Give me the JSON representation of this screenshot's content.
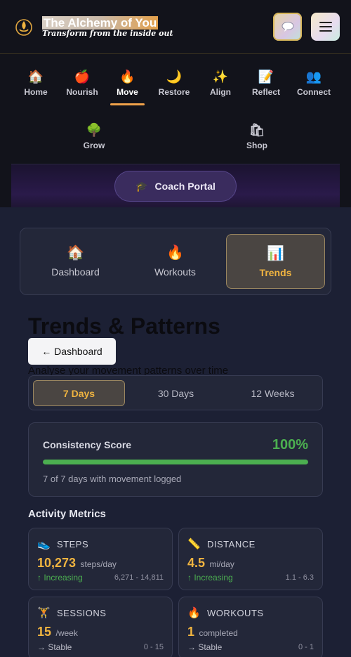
{
  "header": {
    "title": "The Alchemy of You",
    "tagline": "Transform from the inside out",
    "logo_icon": "lotus-flame-icon",
    "chat_icon": "speech-bubble-icon",
    "menu_icon": "hamburger-icon"
  },
  "nav": {
    "items": [
      {
        "label": "Home",
        "icon": "🏠"
      },
      {
        "label": "Nourish",
        "icon": "🍎"
      },
      {
        "label": "Move",
        "icon": "🔥"
      },
      {
        "label": "Restore",
        "icon": "🌙"
      },
      {
        "label": "Align",
        "icon": "✨"
      },
      {
        "label": "Reflect",
        "icon": "📝"
      },
      {
        "label": "Connect",
        "icon": "👥"
      },
      {
        "label": "Grow",
        "icon": "🌳"
      },
      {
        "label": "Shop",
        "icon": "🛍"
      }
    ],
    "active": "Move",
    "coach_label": "Coach Portal",
    "coach_icon": "🎓"
  },
  "subtabs": {
    "items": [
      {
        "label": "Dashboard",
        "icon": "🏠"
      },
      {
        "label": "Workouts",
        "icon": "🔥"
      },
      {
        "label": "Trends",
        "icon": "📊"
      }
    ],
    "active": "Trends"
  },
  "page": {
    "title": "Trends & Patterns",
    "back_label": "← Dashboard",
    "subtitle": "Analyse your movement patterns over time"
  },
  "period": {
    "options": [
      "7 Days",
      "30 Days",
      "12 Weeks"
    ],
    "active": "7 Days"
  },
  "consistency": {
    "label": "Consistency Score",
    "value_text": "100%",
    "fill_fraction": 1.0,
    "note": "7 of 7 days with movement logged"
  },
  "metrics_heading": "Activity Metrics",
  "metrics": [
    {
      "name": "STEPS",
      "icon": "👟",
      "value": "10,273",
      "unit": "steps/day",
      "trend": "↑ Increasing",
      "trend_kind": "up",
      "range": "6,271 - 14,811"
    },
    {
      "name": "DISTANCE",
      "icon": "📏",
      "value": "4.5",
      "unit": "mi/day",
      "trend": "↑ Increasing",
      "trend_kind": "up",
      "range": "1.1 - 6.3"
    },
    {
      "name": "SESSIONS",
      "icon": "🏋",
      "value": "15",
      "unit": "/week",
      "trend": "→ Stable",
      "trend_kind": "flat",
      "range": "0 - 15"
    },
    {
      "name": "WORKOUTS",
      "icon": "🔥",
      "value": "1",
      "unit": "completed",
      "trend": "→ Stable",
      "trend_kind": "flat",
      "range": "0 - 1"
    }
  ],
  "colors": {
    "accent": "#f0b440",
    "success": "#4caf50",
    "background": "#1c2034",
    "header": "#12131b"
  }
}
